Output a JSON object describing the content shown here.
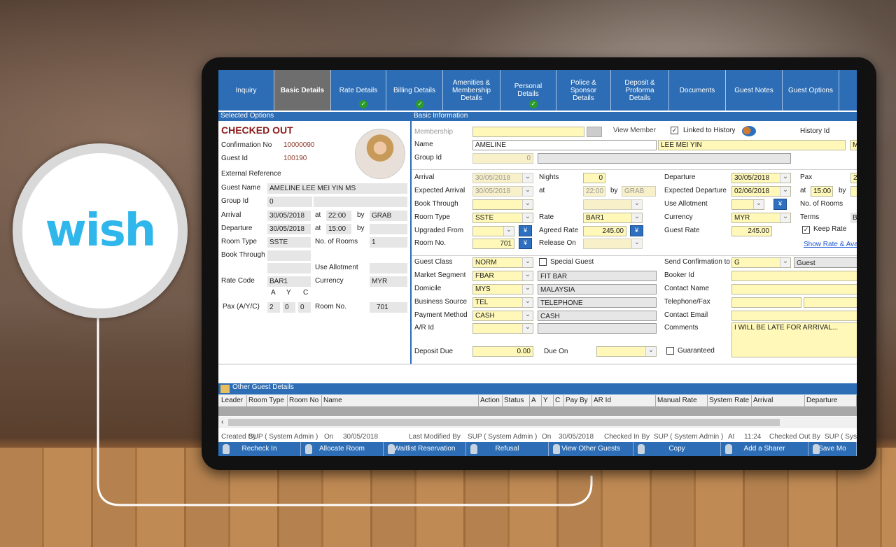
{
  "brand": {
    "logo_text": "wish",
    "color": "#2fb7ec"
  },
  "tabs": [
    {
      "label": "Inquiry"
    },
    {
      "label": "Basic Details",
      "active": true
    },
    {
      "label": "Rate Details",
      "done": true
    },
    {
      "label": "Billing Details",
      "done": true
    },
    {
      "label": "Amenities & Membership Details"
    },
    {
      "label": "Personal Details",
      "done": true
    },
    {
      "label": "Police & Sponsor Details"
    },
    {
      "label": "Deposit & Proforma Details"
    },
    {
      "label": "Documents"
    },
    {
      "label": "Guest Notes"
    },
    {
      "label": "Guest Options"
    },
    {
      "label": "G"
    }
  ],
  "selected": {
    "title": "Selected Options",
    "status": "CHECKED OUT",
    "confirmation_label": "Confirmation No",
    "confirmation": "10000090",
    "guest_id_label": "Guest Id",
    "guest_id": "100190",
    "ext_ref_label": "External Reference",
    "guest_name_label": "Guest Name",
    "guest_name": "AMELINE LEE MEI YIN MS",
    "group_id_label": "Group Id",
    "group_id": "0",
    "arrival_label": "Arrival",
    "arrival": "30/05/2018",
    "at": "at",
    "by": "by",
    "arrival_time": "22:00",
    "arrival_by": "GRAB",
    "departure_label": "Departure",
    "departure": "30/05/2018",
    "departure_time": "15:00",
    "room_type_label": "Room Type",
    "room_type": "SSTE",
    "rooms_label": "No. of Rooms",
    "rooms": "1",
    "book_through_label": "Book Through",
    "use_allotment_label": "Use Allotment",
    "rate_code_label": "Rate Code",
    "rate_code": "BAR1",
    "currency_label": "Currency",
    "currency": "MYR",
    "a": "A",
    "y": "Y",
    "c": "C",
    "pax_label": "Pax (A/Y/C)",
    "pax_a": "2",
    "pax_y": "0",
    "pax_c": "0",
    "room_no_label": "Room No.",
    "room_no": "701"
  },
  "basic": {
    "title": "Basic Information",
    "membership_label": "Membership",
    "view_member": "View Member",
    "linked_history": "Linked to History",
    "history_id_label": "History Id",
    "name_label": "Name",
    "first_name": "AMELINE",
    "last_name": "LEE MEI YIN",
    "title_short": "M",
    "group_id_label": "Group Id",
    "group_id": "0",
    "arrival_label": "Arrival",
    "arrival": "30/05/2018",
    "nights_label": "Nights",
    "nights": "0",
    "departure_label": "Departure",
    "departure": "30/05/2018",
    "pax_label": "Pax",
    "pax": "2",
    "exp_arrival_label": "Expected Arrival",
    "exp_arrival": "30/05/2018",
    "at": "at",
    "exp_arrival_time": "22:00",
    "by": "by",
    "exp_arrival_by": "GRAB",
    "exp_departure_label": "Expected Departure",
    "exp_departure": "02/06/2018",
    "exp_departure_time": "15:00",
    "book_through_label": "Book Through",
    "use_allotment_label": "Use Allotment",
    "rooms_label": "No. of Rooms",
    "room_type_label": "Room Type",
    "room_type": "SSTE",
    "rate_label": "Rate",
    "rate": "BAR1",
    "currency_label": "Currency",
    "currency": "MYR",
    "terms_label": "Terms",
    "terms": "B",
    "upgraded_label": "Upgraded From",
    "agreed_rate_label": "Agreed Rate",
    "agreed_rate": "245.00",
    "guest_rate_label": "Guest Rate",
    "guest_rate": "245.00",
    "keep_rate": "Keep Rate",
    "room_no_label": "Room No.",
    "room_no": "701",
    "release_on_label": "Release On",
    "show_rate_link": "Show Rate & Avai",
    "guest_class_label": "Guest Class",
    "guest_class": "NORM",
    "special_guest": "Special Guest",
    "send_conf_label": "Send Confirmation to",
    "send_conf": "G",
    "send_conf_desc": "Guest",
    "market_label": "Market Segment",
    "market": "FBAR",
    "market_desc": "FIT BAR",
    "booker_label": "Booker Id",
    "domicile_label": "Domicile",
    "domicile": "MYS",
    "domicile_desc": "MALAYSIA",
    "contact_name_label": "Contact Name",
    "source_label": "Business Source",
    "source": "TEL",
    "source_desc": "TELEPHONE",
    "tel_label": "Telephone/Fax",
    "payment_label": "Payment Method",
    "payment": "CASH",
    "payment_desc": "CASH",
    "email_label": "Contact Email",
    "ar_label": "A/R Id",
    "comments_label": "Comments",
    "comments": "I WILL BE LATE FOR ARRIVAL...",
    "deposit_label": "Deposit Due",
    "deposit": "0.00",
    "due_on_label": "Due On",
    "guaranteed": "Guaranteed"
  },
  "other": {
    "title": "Other Guest Details",
    "columns": [
      "Leader",
      "Room Type",
      "Room No",
      "Name",
      "Action",
      "Status",
      "A",
      "Y",
      "C",
      "Pay By",
      "AR Id",
      "Manual Rate",
      "System Rate",
      "Arrival",
      "Departure"
    ]
  },
  "status": [
    "Created By",
    "SUP ( System Admin )",
    "On",
    "30/05/2018",
    "Last Modified By",
    "SUP ( System Admin )",
    "On",
    "30/05/2018",
    "Checked In By",
    "SUP ( System Admin )",
    "At",
    "11:24",
    "Checked Out By",
    "SUP ( Sys"
  ],
  "buttons": [
    "Recheck In",
    "Allocate Room",
    "Waitlist Reservation",
    "Refusal",
    "View Other Guests",
    "Copy",
    "Add a Sharer",
    "Save Mo"
  ]
}
